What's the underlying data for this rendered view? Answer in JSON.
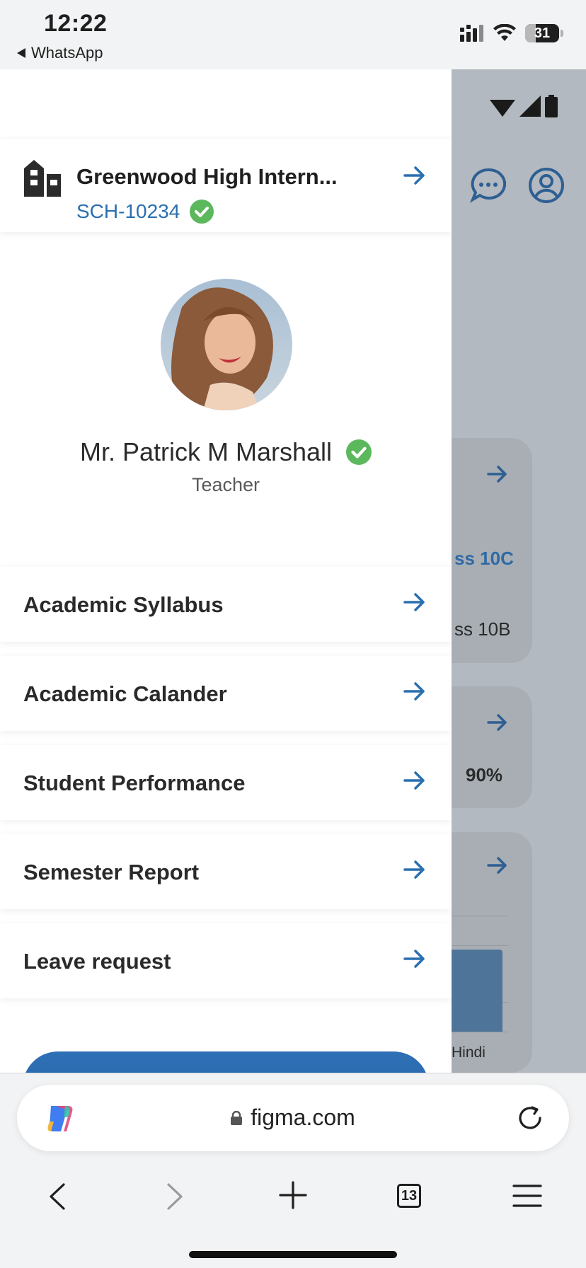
{
  "status_bar": {
    "time": "12:22",
    "back_app": "WhatsApp",
    "battery_level": "31",
    "battery_fraction": 0.31
  },
  "background_app": {
    "card1_class_a": "ss 10C",
    "card1_class_b": "ss 10B",
    "card2_percent": "90%",
    "card3_subject": "Hindi"
  },
  "drawer": {
    "school": {
      "name": "Greenwood High Intern...",
      "id": "SCH-10234",
      "icon": "school-building-icon"
    },
    "profile": {
      "name": "Mr. Patrick M Marshall",
      "role": "Teacher"
    },
    "menu": [
      {
        "label": "Academic Syllabus"
      },
      {
        "label": "Academic Calander"
      },
      {
        "label": "Student Performance"
      },
      {
        "label": "Semester Report"
      },
      {
        "label": "Leave request"
      }
    ]
  },
  "browser": {
    "url": "figma.com",
    "tabs_count": "13"
  },
  "colors": {
    "accent": "#2a6fb0",
    "verified": "#5cb85c",
    "overlay": "#b3b9c0"
  }
}
